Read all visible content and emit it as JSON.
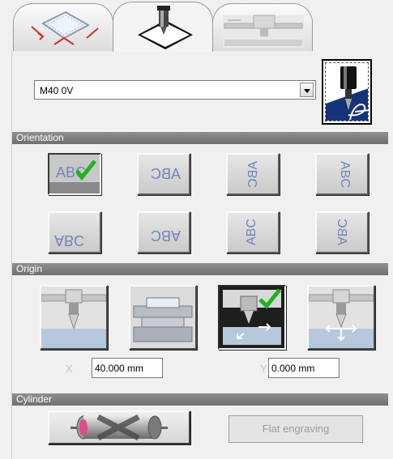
{
  "tabs": [
    {
      "name": "tab-engraving-area",
      "icon": "engraving-area-icon",
      "active": false
    },
    {
      "name": "tab-tool",
      "icon": "tool-plate-icon",
      "active": true
    },
    {
      "name": "tab-machine",
      "icon": "machine-icon",
      "active": false
    }
  ],
  "tool": {
    "selected": "M40 0V",
    "icon": "engraving-tool-icon"
  },
  "sections": {
    "orientation": "Orientation",
    "origin": "Origin",
    "cylinder": "Cylinder"
  },
  "orientation": {
    "text_top_left": "ABC",
    "selected_index": 0
  },
  "origin": {
    "selected_index": 2,
    "x_label": "X",
    "x_value": "40.000 mm",
    "y_label": "Y",
    "y_value": "0.000 mm"
  },
  "cylinder": {
    "button_icon": "cylinder-icon",
    "flat_label": "Flat engraving"
  },
  "colors": {
    "check": "#1fb31f",
    "header": "#808080",
    "text_blue": "#6f84b8"
  }
}
